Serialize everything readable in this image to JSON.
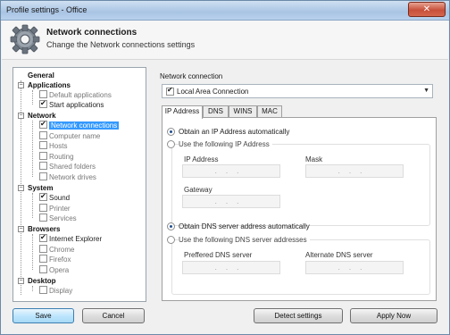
{
  "window": {
    "title": "Profile settings - Office",
    "close_glyph": "✕"
  },
  "header": {
    "title": "Network connections",
    "subtitle": "Change the Network connections settings",
    "icon": "gear-icon"
  },
  "tree": {
    "general": "General",
    "applications": "Applications",
    "default_applications": "Default applications",
    "start_applications": "Start applications",
    "network": "Network",
    "network_connections": "Network connections",
    "computer_name": "Computer name",
    "hosts": "Hosts",
    "routing": "Routing",
    "shared_folders": "Shared folders",
    "network_drives": "Network drives",
    "system": "System",
    "sound": "Sound",
    "printer": "Printer",
    "services": "Services",
    "browsers": "Browsers",
    "internet_explorer": "Internet Explorer",
    "chrome": "Chrome",
    "firefox": "Firefox",
    "opera": "Opera",
    "desktop": "Desktop",
    "display": "Display",
    "expander_glyph": "−"
  },
  "connection": {
    "label": "Network connection",
    "selected": "Local Area Connection",
    "arrow": "▼"
  },
  "tabs": {
    "ip": "IP Address",
    "dns": "DNS",
    "wins": "WINS",
    "mac": "MAC"
  },
  "ip_panel": {
    "auto_ip": "Obtain an IP Address automatically",
    "manual_ip": "Use the following IP Address",
    "ip_address_label": "IP Address",
    "mask_label": "Mask",
    "gateway_label": "Gateway",
    "auto_dns": "Obtain DNS server address automatically",
    "manual_dns": "Use the following DNS server addresses",
    "preferred_dns_label": "Preffered DNS server",
    "alternate_dns_label": "Alternate DNS server",
    "ip_placeholder": "...",
    "auto_ip_selected": true,
    "auto_dns_selected": true
  },
  "buttons": {
    "save": "Save",
    "cancel": "Cancel",
    "detect": "Detect settings",
    "apply": "Apply Now"
  },
  "colors": {
    "accent": "#3399ff",
    "title_bar": "#a9c4e4",
    "close": "#c8503a"
  }
}
